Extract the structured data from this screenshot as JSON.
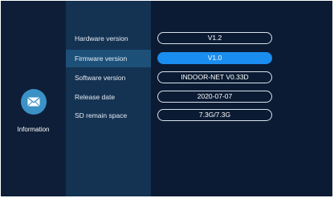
{
  "sidebar": {
    "app_label": "Information",
    "icon": "envelope-icon",
    "icon_color": "#3a92c6"
  },
  "info": {
    "rows": [
      {
        "label": "Hardware version",
        "value": "V1.2"
      },
      {
        "label": "Firmware version",
        "value": "V1.0"
      },
      {
        "label": "Software version",
        "value": "INDOOR-NET V0.33D"
      },
      {
        "label": "Release date",
        "value": "2020-07-07"
      },
      {
        "label": "SD remain space",
        "value": "7.3G/7.3G"
      }
    ],
    "selected_index": 1
  },
  "colors": {
    "background": "#0b1b33",
    "menu_panel": "#143252",
    "selected_row": "#1c5078",
    "selected_pill": "#1a8df0"
  }
}
